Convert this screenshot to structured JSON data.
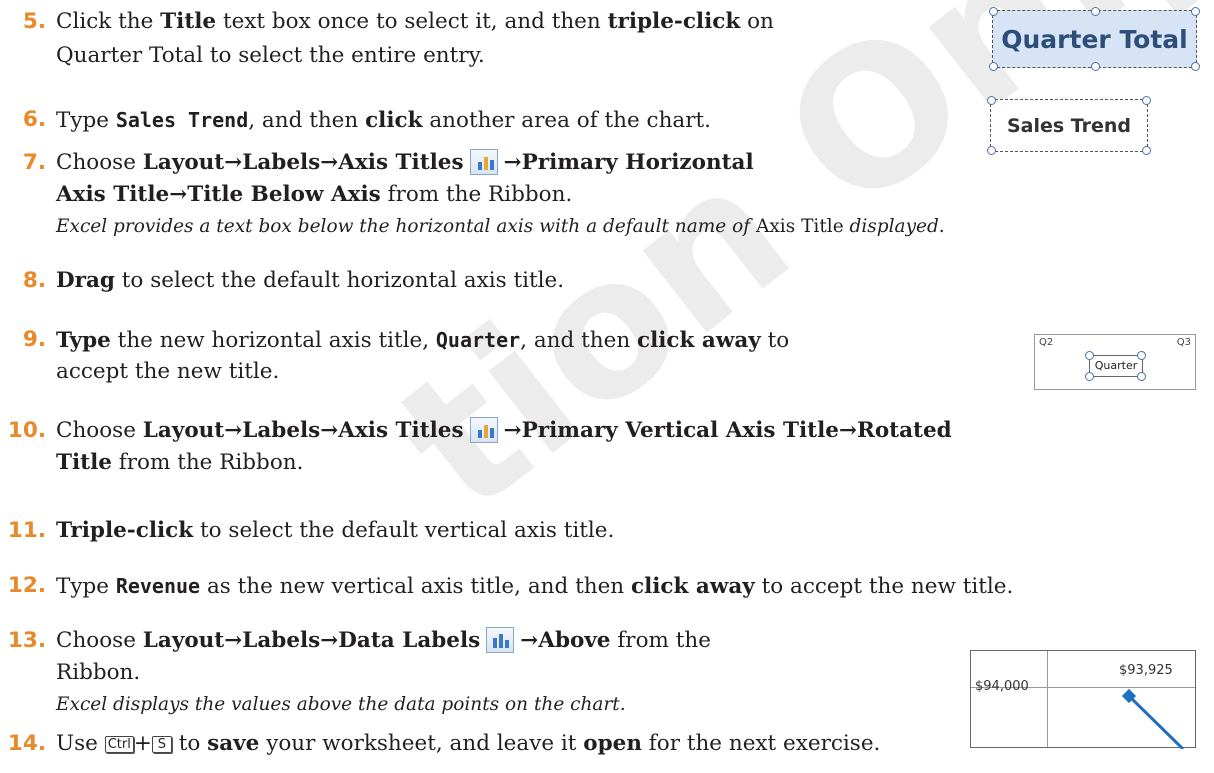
{
  "watermark": "tion Only",
  "steps": [
    {
      "num": "5.",
      "lines": [
        {
          "a": "Click the ",
          "b": "Title",
          "c": " text box once to select it, and then ",
          "d": "triple-click",
          "e": " on"
        },
        {
          "a": "Quarter Total to select the entire entry."
        }
      ]
    },
    {
      "num": "6.",
      "line": {
        "a": "Type ",
        "mono": "Sales Trend",
        "c": ", and then ",
        "d": "click",
        "e": " another area of the chart."
      }
    },
    {
      "num": "7.",
      "lines": [
        {
          "a": "Choose ",
          "b": "Layout→Labels→Axis Titles",
          "icon": "axis-titles-icon",
          "d": "→Primary Horizontal"
        },
        {
          "b": "Axis Title→Title Below Axis",
          "c": " from the Ribbon."
        },
        {
          "note_a": "Excel provides a text box below the horizontal axis with a default name of ",
          "note_b": "Axis Title",
          "note_c": " displayed."
        }
      ]
    },
    {
      "num": "8.",
      "line": {
        "b": "Drag",
        "c": " to select the default horizontal axis title."
      }
    },
    {
      "num": "9.",
      "lines": [
        {
          "b": "Type",
          "c": " the new horizontal axis title, ",
          "mono": "Quarter",
          "d": ", and then ",
          "e": "click away",
          "f": " to"
        },
        {
          "a": "accept the new title."
        }
      ]
    },
    {
      "num": "10.",
      "lines": [
        {
          "a": "Choose ",
          "b": "Layout→Labels→Axis Titles",
          "icon": "axis-titles-icon",
          "d": "→Primary Vertical Axis Title→Rotated"
        },
        {
          "b": "Title",
          "c": " from the Ribbon."
        }
      ]
    },
    {
      "num": "11.",
      "line": {
        "b": "Triple-click",
        "c": " to select the default vertical axis title."
      }
    },
    {
      "num": "12.",
      "line": {
        "a": "Type ",
        "mono": "Revenue",
        "c": " as the new vertical axis title, and then ",
        "d": "click away",
        "e": " to accept the new title."
      }
    },
    {
      "num": "13.",
      "lines": [
        {
          "a": "Choose ",
          "b": "Layout→Labels→Data Labels",
          "icon": "data-labels-icon",
          "d": "→Above",
          "e": " from the"
        },
        {
          "a": "Ribbon."
        },
        {
          "note_a": "Excel displays the values above the data points on the chart."
        }
      ]
    },
    {
      "num": "14.",
      "line": {
        "a": "Use ",
        "k1": "Ctrl",
        "plus": "+",
        "k2": "S",
        "c": " to ",
        "d": "save",
        "e": " your worksheet, and leave it ",
        "f": "open",
        "g": " for the next exercise."
      }
    }
  ],
  "figures": {
    "quarter_total": "Quarter Total",
    "sales_trend": "Sales Trend",
    "axis_q2": "Q2",
    "axis_q3": "Q3",
    "axis_quarter": "Quarter",
    "y_label": "$94,000",
    "point_label": "$93,925"
  },
  "colors": {
    "step_number": "#e8892b",
    "title_box_fill": "#d6e4f5",
    "title_text": "#2c4e79",
    "series_line": "#1f6fbf"
  }
}
